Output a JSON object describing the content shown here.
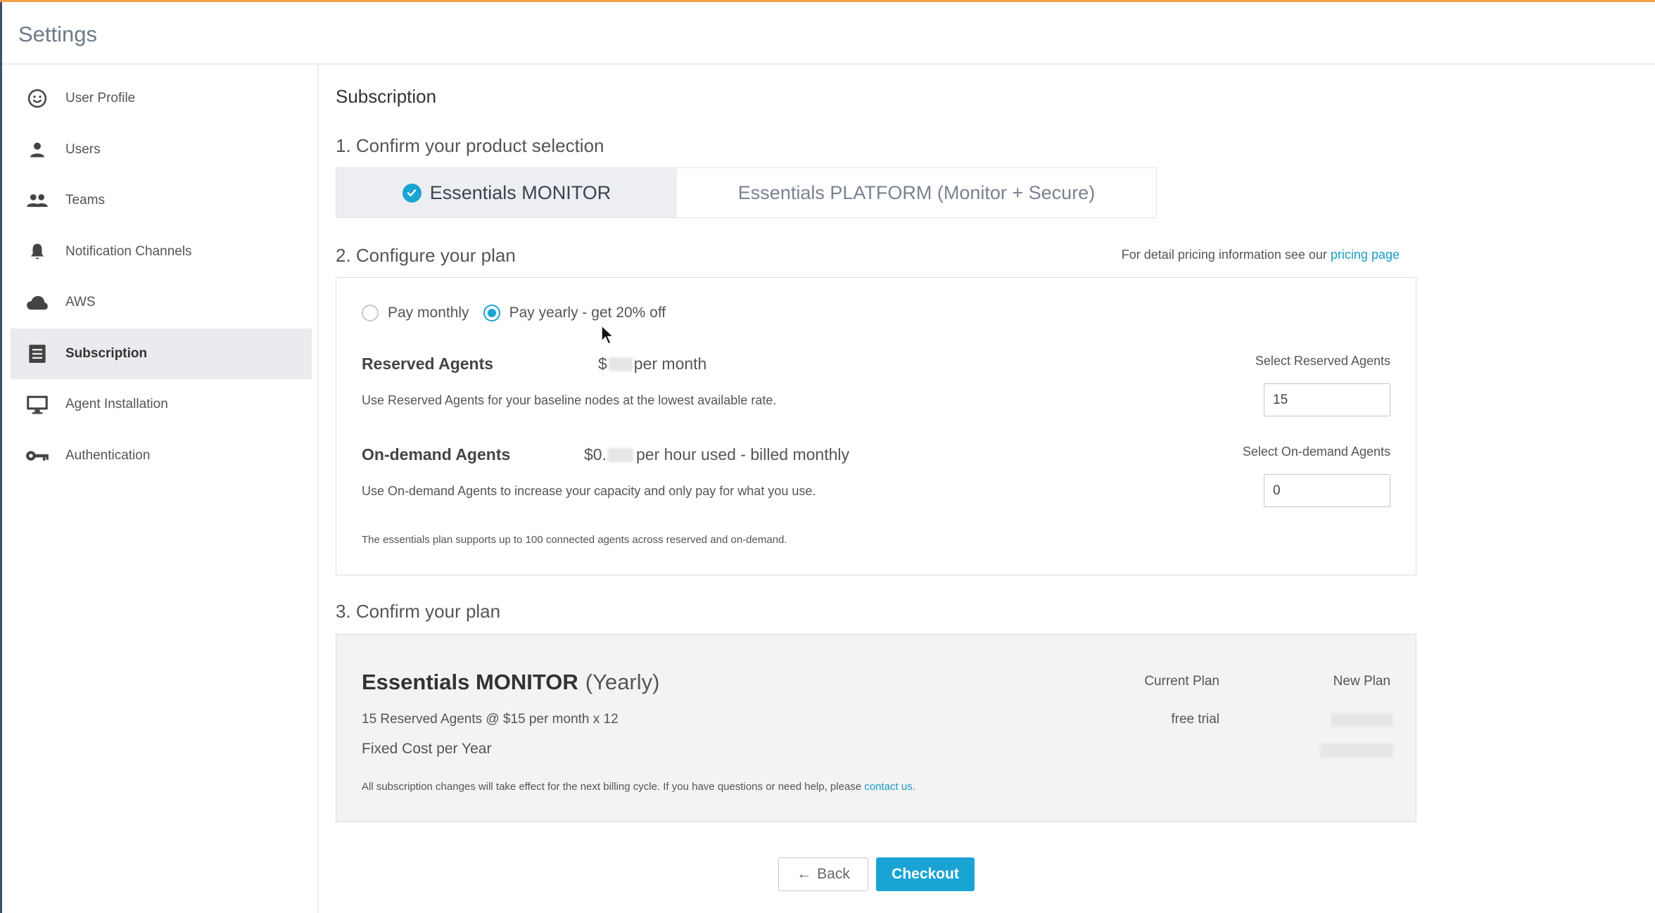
{
  "app": {
    "title": "Settings"
  },
  "sidebar": {
    "items": [
      {
        "label": "User Profile",
        "icon": "smiley-icon",
        "active": false
      },
      {
        "label": "Users",
        "icon": "person-icon",
        "active": false
      },
      {
        "label": "Teams",
        "icon": "people-icon",
        "active": false
      },
      {
        "label": "Notification Channels",
        "icon": "bell-icon",
        "active": false
      },
      {
        "label": "AWS",
        "icon": "cloud-icon",
        "active": false
      },
      {
        "label": "Subscription",
        "icon": "list-icon",
        "active": true
      },
      {
        "label": "Agent Installation",
        "icon": "monitor-icon",
        "active": false
      },
      {
        "label": "Authentication",
        "icon": "key-icon",
        "active": false
      }
    ]
  },
  "main": {
    "title": "Subscription",
    "step1": {
      "title": "1. Confirm your product selection",
      "options": [
        {
          "label": "Essentials MONITOR",
          "selected": true
        },
        {
          "label": "Essentials PLATFORM (Monitor + Secure)",
          "selected": false
        }
      ]
    },
    "step2": {
      "title": "2. Configure your plan",
      "pricing_text": "For detail pricing information see our ",
      "pricing_link": "pricing page",
      "billing": {
        "monthly_label": "Pay monthly",
        "yearly_label": "Pay yearly - get 20% off",
        "selected": "yearly"
      },
      "reserved": {
        "name": "Reserved Agents",
        "price_prefix": "$",
        "price_suffix": "per month",
        "desc": "Use Reserved Agents for your baseline nodes at the lowest available rate.",
        "select_label": "Select Reserved Agents",
        "value": "15"
      },
      "ondemand": {
        "name": "On-demand Agents",
        "price_prefix": "$0.",
        "price_suffix": "per hour used - billed monthly",
        "desc": "Use On-demand Agents to increase your capacity and only pay for what you use.",
        "select_label": "Select On-demand Agents",
        "value": "0"
      },
      "note": "The essentials plan supports up to 100 connected agents across reserved and on-demand."
    },
    "step3": {
      "title": "3. Confirm your plan",
      "plan_name": "Essentials MONITOR",
      "plan_period": "(Yearly)",
      "current_plan_label": "Current Plan",
      "new_plan_label": "New Plan",
      "line1": "15 Reserved Agents @ $15 per month x 12",
      "line1_current": "free trial",
      "line2": "Fixed Cost per Year",
      "footer_text": "All subscription changes will take effect for the next billing cycle. If you have questions or need help, please ",
      "footer_link": "contact us."
    },
    "actions": {
      "back_arrow": "←",
      "back_label": "Back",
      "checkout_label": "Checkout"
    }
  },
  "colors": {
    "accent": "#1aa4d4",
    "top_border": "#f0a24a",
    "sidebar_active": "#e9ebee"
  }
}
